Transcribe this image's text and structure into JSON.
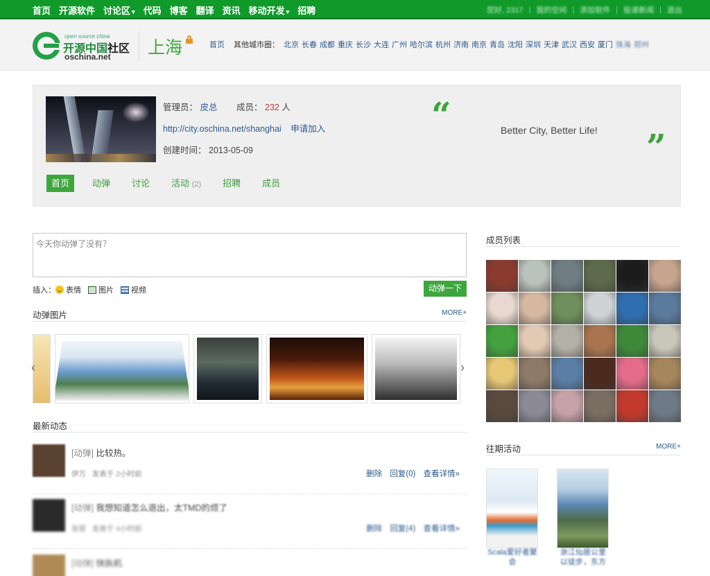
{
  "topnav": {
    "items": [
      {
        "label": "首页",
        "dropdown": false
      },
      {
        "label": "开源软件",
        "dropdown": false
      },
      {
        "label": "讨论区",
        "dropdown": true
      },
      {
        "label": "代码",
        "dropdown": false
      },
      {
        "label": "博客",
        "dropdown": false
      },
      {
        "label": "翻译",
        "dropdown": false
      },
      {
        "label": "资讯",
        "dropdown": false
      },
      {
        "label": "移动开发",
        "dropdown": true
      },
      {
        "label": "招聘",
        "dropdown": false
      }
    ],
    "right": [
      "您好, 2317",
      "我的空间",
      "添加软件",
      "投递新闻",
      "退出"
    ]
  },
  "logo": {
    "small": "open source china",
    "main_green": "开源中国",
    "main_dark": "社区",
    "domain": "oschina.net"
  },
  "city": {
    "name": "上海"
  },
  "citylinks": {
    "home": "首页",
    "others_label": "其他城市圈：",
    "cities": [
      "北京",
      "长春",
      "成都",
      "重庆",
      "长沙",
      "大连",
      "广州",
      "哈尔滨",
      "杭州",
      "济南",
      "南京",
      "青岛",
      "沈阳",
      "深圳",
      "天津",
      "武汉",
      "西安",
      "厦门",
      "珠海",
      "郑州"
    ]
  },
  "profile": {
    "admin_label": "管理员：",
    "admin_name": "皮总",
    "members_label": "成员：",
    "members_count": "232",
    "members_unit": "人",
    "url": "http://city.oschina.net/shanghai",
    "join": "申请加入",
    "created_label": "创建时间：",
    "created_date": "2013-05-09",
    "slogan": "Better City, Better Life!",
    "quote_open": "“",
    "quote_close": "”",
    "tabs": [
      {
        "label": "首页",
        "count": ""
      },
      {
        "label": "动弹",
        "count": ""
      },
      {
        "label": "讨论",
        "count": ""
      },
      {
        "label": "活动",
        "count": "(2)"
      },
      {
        "label": "招聘",
        "count": ""
      },
      {
        "label": "成员",
        "count": ""
      }
    ]
  },
  "compose": {
    "placeholder": "今天你动弹了没有？",
    "insert_label": "插入：",
    "emoji": "表情",
    "image": "图片",
    "video": "视频",
    "submit": "动弹一下"
  },
  "photos": {
    "title": "动弹图片",
    "more": "MORE+",
    "prev": "‹",
    "next": "›"
  },
  "feed": {
    "title": "最新动态",
    "items": [
      {
        "tag": "[动弹]",
        "text": "比较热。",
        "author": "伊万",
        "time": "发表于 2小时前",
        "actions": [
          "删除",
          "回复(0)",
          "查看详情»"
        ]
      },
      {
        "tag": "[动弹]",
        "text": "我想知道怎么退出，太TMD的烦了",
        "author": "张官",
        "time": "发表于 4小时前",
        "actions": [
          "删除",
          "回复(4)",
          "查看详情»"
        ]
      },
      {
        "tag": "[动弹]",
        "text": "快执机",
        "author": "",
        "time": "",
        "actions": []
      }
    ]
  },
  "members": {
    "title": "成员列表",
    "avatar_colors": [
      "#8b3a2e",
      "#b9c2bc",
      "#6f7d83",
      "#5d6a4b",
      "#1c1c1c",
      "#c7a48d",
      "#e7d8d0",
      "#d6b8a0",
      "#6f8f5d",
      "#cfd3d6",
      "#2f6fb0",
      "#5a7a9e",
      "#44a23e",
      "#e2c9b3",
      "#b3b0a7",
      "#a9744f",
      "#3f8a3a",
      "#c9c7b9",
      "#e8c776",
      "#8d7a67",
      "#5b7ea6",
      "#4b2a1e",
      "#e46b8a",
      "#a6865c",
      "#5a4a3e",
      "#8c8a95",
      "#c5a1a8",
      "#7a6e63",
      "#c23a2e",
      "#6e7a86"
    ]
  },
  "activities": {
    "title": "往期活动",
    "more": "MORE+",
    "items": [
      {
        "caption_line1": "Scala爱好者聚",
        "caption_line2": "会"
      },
      {
        "caption_line1": "浙江仙居公里",
        "caption_line2": "以徒步，东方"
      }
    ]
  }
}
